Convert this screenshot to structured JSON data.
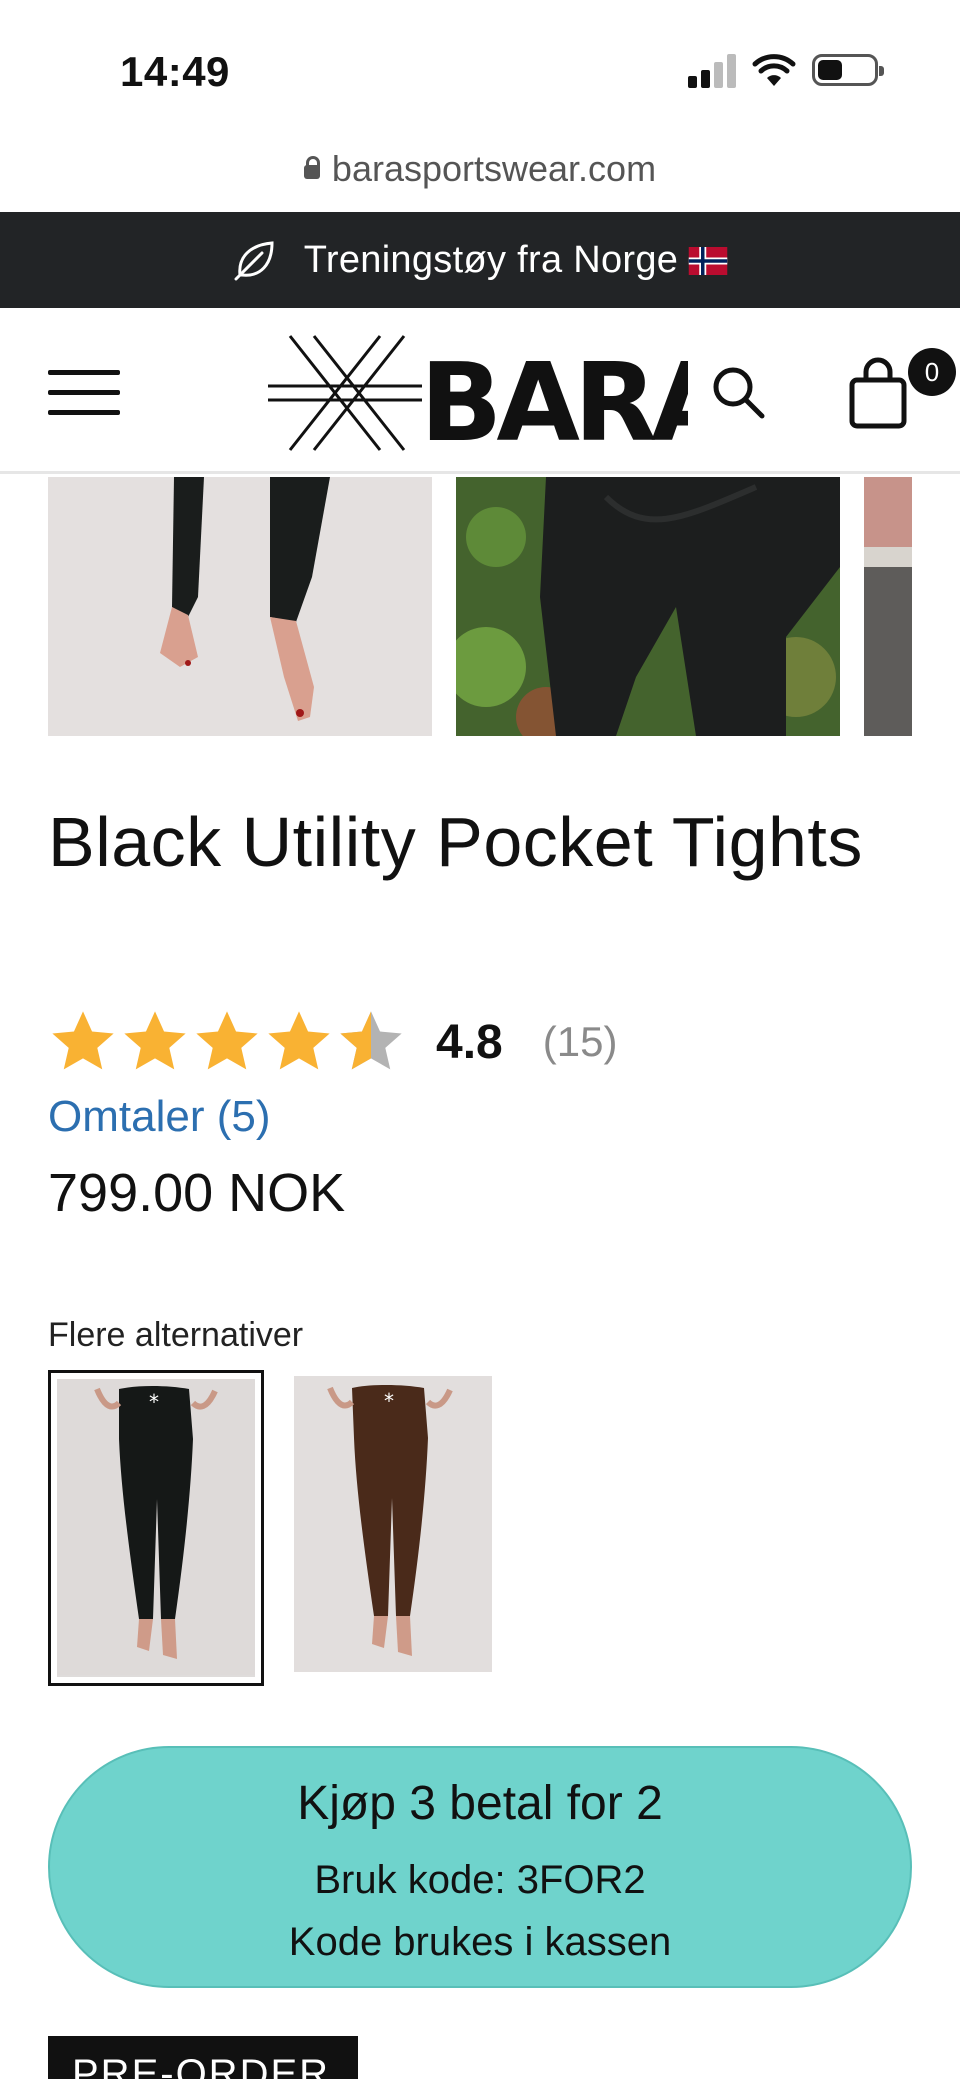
{
  "status_bar": {
    "time": "14:49"
  },
  "browser": {
    "url": "barasportswear.com"
  },
  "announcement": {
    "text": "Treningstøy fra Norge",
    "flag_icon": "norway-flag-icon",
    "icon": "leaf-icon"
  },
  "header": {
    "menu_icon": "hamburger-menu-icon",
    "logo_text": "BARA",
    "search_icon": "search-icon",
    "cart_icon": "shopping-bag-icon",
    "cart_count": "0"
  },
  "product": {
    "title": "Black Utility Pocket Tights",
    "rating": {
      "value": "4.8",
      "count": "(15)",
      "stars": 4.5
    },
    "reviews_link": "Omtaler (5)",
    "price": "799.00 NOK"
  },
  "alternatives": {
    "label": "Flere alternativer",
    "items": [
      {
        "name": "black",
        "selected": true
      },
      {
        "name": "brown",
        "selected": false
      }
    ]
  },
  "promo": {
    "title": "Kjøp 3 betal for 2",
    "line1": "Bruk kode: 3FOR2",
    "line2": "Kode brukes i kassen",
    "color": "#6fd3cc"
  },
  "preorder": {
    "label": "PRE-ORDER"
  },
  "colors": {
    "announce_bg": "#222426",
    "link": "#2c6fb0",
    "star": "#f9b233",
    "star_empty": "#b3b3b3"
  }
}
